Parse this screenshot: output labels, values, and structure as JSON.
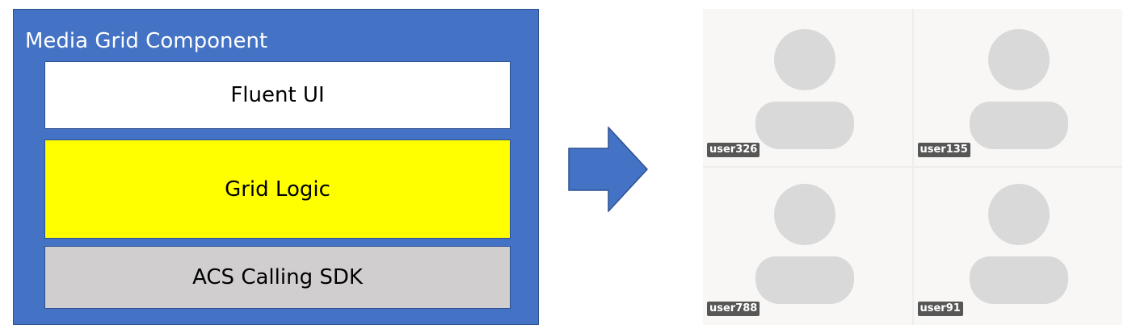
{
  "diagram": {
    "container_title": "Media Grid Component",
    "layers": [
      {
        "label": "Fluent UI",
        "color": "#ffffff"
      },
      {
        "label": "Grid Logic",
        "color": "#ffff00"
      },
      {
        "label": "ACS Calling SDK",
        "color": "#d0cece"
      }
    ],
    "container_color": "#4472c4"
  },
  "arrow": {
    "icon": "right-arrow-icon",
    "color": "#4472c4"
  },
  "video_grid": {
    "tiles": [
      {
        "name": "user326",
        "icon": "person-placeholder-icon"
      },
      {
        "name": "user135",
        "icon": "person-placeholder-icon"
      },
      {
        "name": "user788",
        "icon": "person-placeholder-icon"
      },
      {
        "name": "user91",
        "icon": "person-placeholder-icon"
      }
    ],
    "tile_color": "#f8f7f6",
    "avatar_color": "#d9d9d9"
  }
}
